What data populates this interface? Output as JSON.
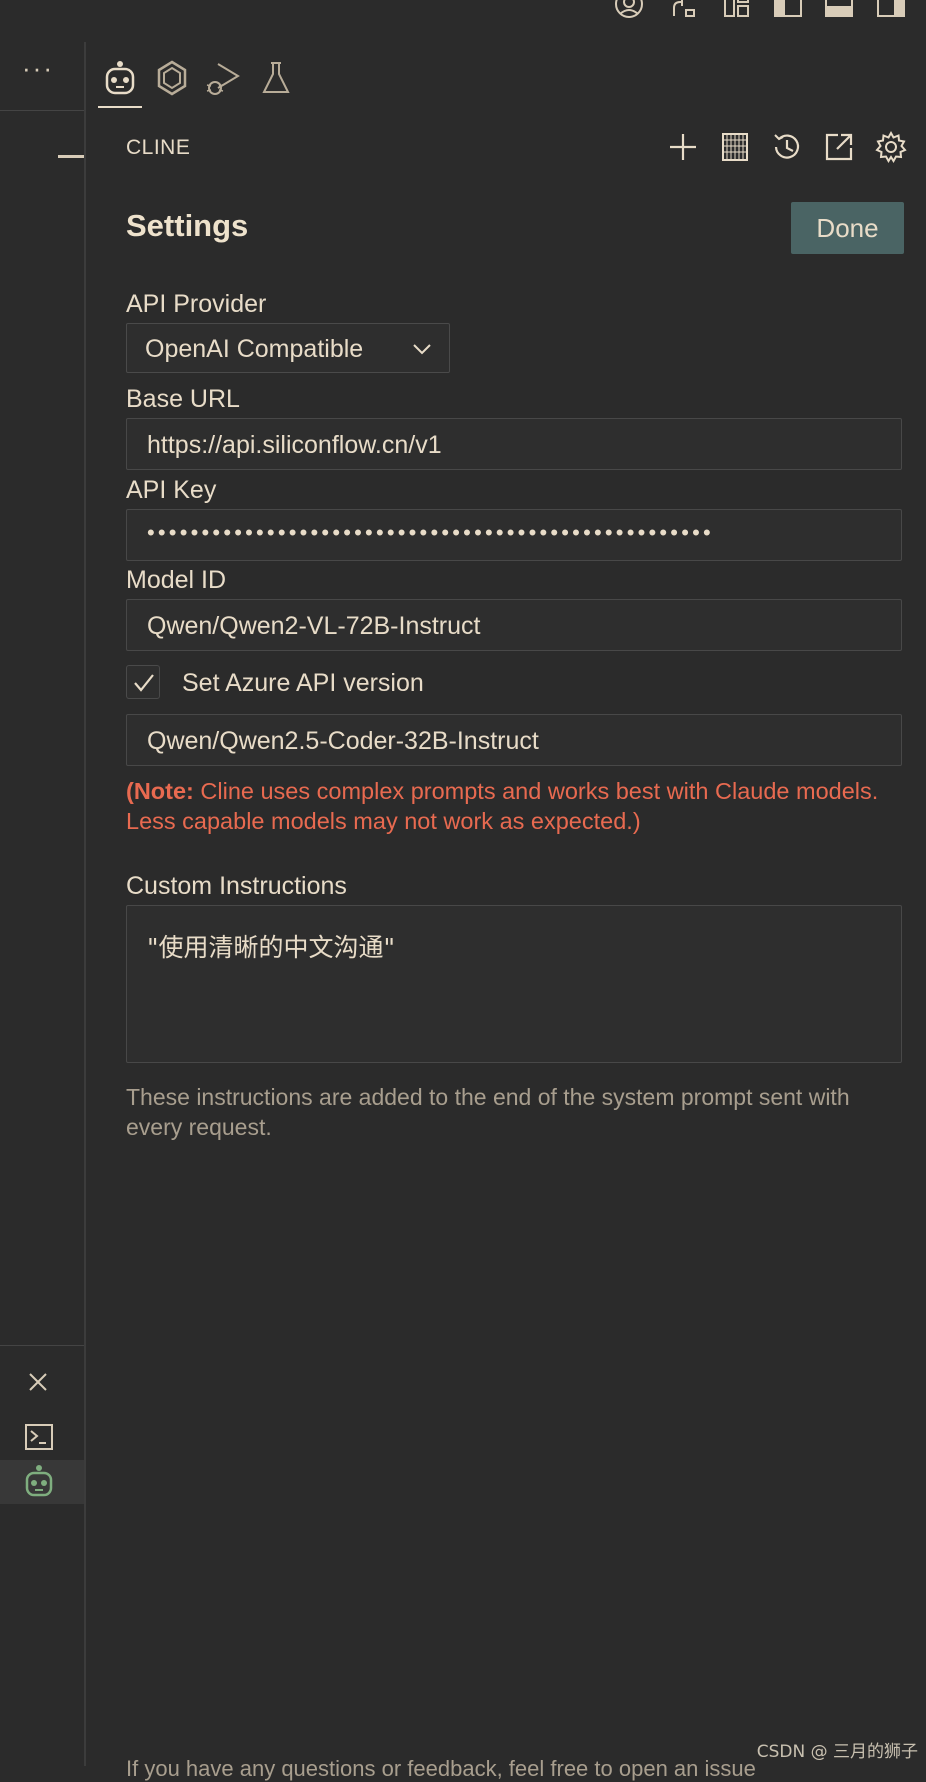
{
  "titlebar": {
    "icons": [
      "account-icon",
      "accounts-share-icon",
      "customize-layout-icon",
      "toggle-primary-sidebar-icon",
      "toggle-panel-icon",
      "toggle-secondary-sidebar-icon"
    ]
  },
  "left_strip": {
    "more_label": "···",
    "icons": [
      "minus-icon",
      "close-icon",
      "terminal-icon",
      "cline-robot-icon"
    ]
  },
  "activity_tabs": [
    {
      "name": "cline-robot-icon",
      "active": true
    },
    {
      "name": "gemini-icon",
      "active": false
    },
    {
      "name": "run-debug-icon",
      "active": false
    },
    {
      "name": "testing-flask-icon",
      "active": false
    }
  ],
  "header": {
    "title": "CLINE",
    "actions": [
      "new-task-icon",
      "mcp-servers-icon",
      "history-icon",
      "open-in-editor-icon",
      "settings-gear-icon"
    ]
  },
  "settings": {
    "title": "Settings",
    "done_label": "Done",
    "api_provider_label": "API Provider",
    "api_provider_value": "OpenAI Compatible",
    "base_url_label": "Base URL",
    "base_url_value": "https://api.siliconflow.cn/v1",
    "api_key_label": "API Key",
    "api_key_value": "••••••••••••••••••••••••••••••••••••••••••••••••••••",
    "model_id_label": "Model ID",
    "model_id_value": "Qwen/Qwen2-VL-72B-Instruct",
    "azure_checkbox_label": "Set Azure API version",
    "azure_checked": true,
    "azure_version_value": "Qwen/Qwen2.5-Coder-32B-Instruct",
    "note_prefix": "(Note:",
    "note_text": " Cline uses complex prompts and works best with Claude models. Less capable models may not work as expected.)",
    "custom_instructions_label": "Custom Instructions",
    "custom_instructions_value": "\"使用清晰的中文沟通\"",
    "custom_instructions_help": "These instructions are added to the end of the system prompt sent with every request.",
    "footer_cut_text": "If you have any questions or feedback, feel free to open an issue"
  },
  "colors": {
    "background": "#2b2b2b",
    "text": "#e8dcc8",
    "done_button": "#4a6464",
    "note_red": "#e86a50",
    "active_robot": "#7fae7f"
  },
  "watermark": "CSDN @ 三月的狮子"
}
